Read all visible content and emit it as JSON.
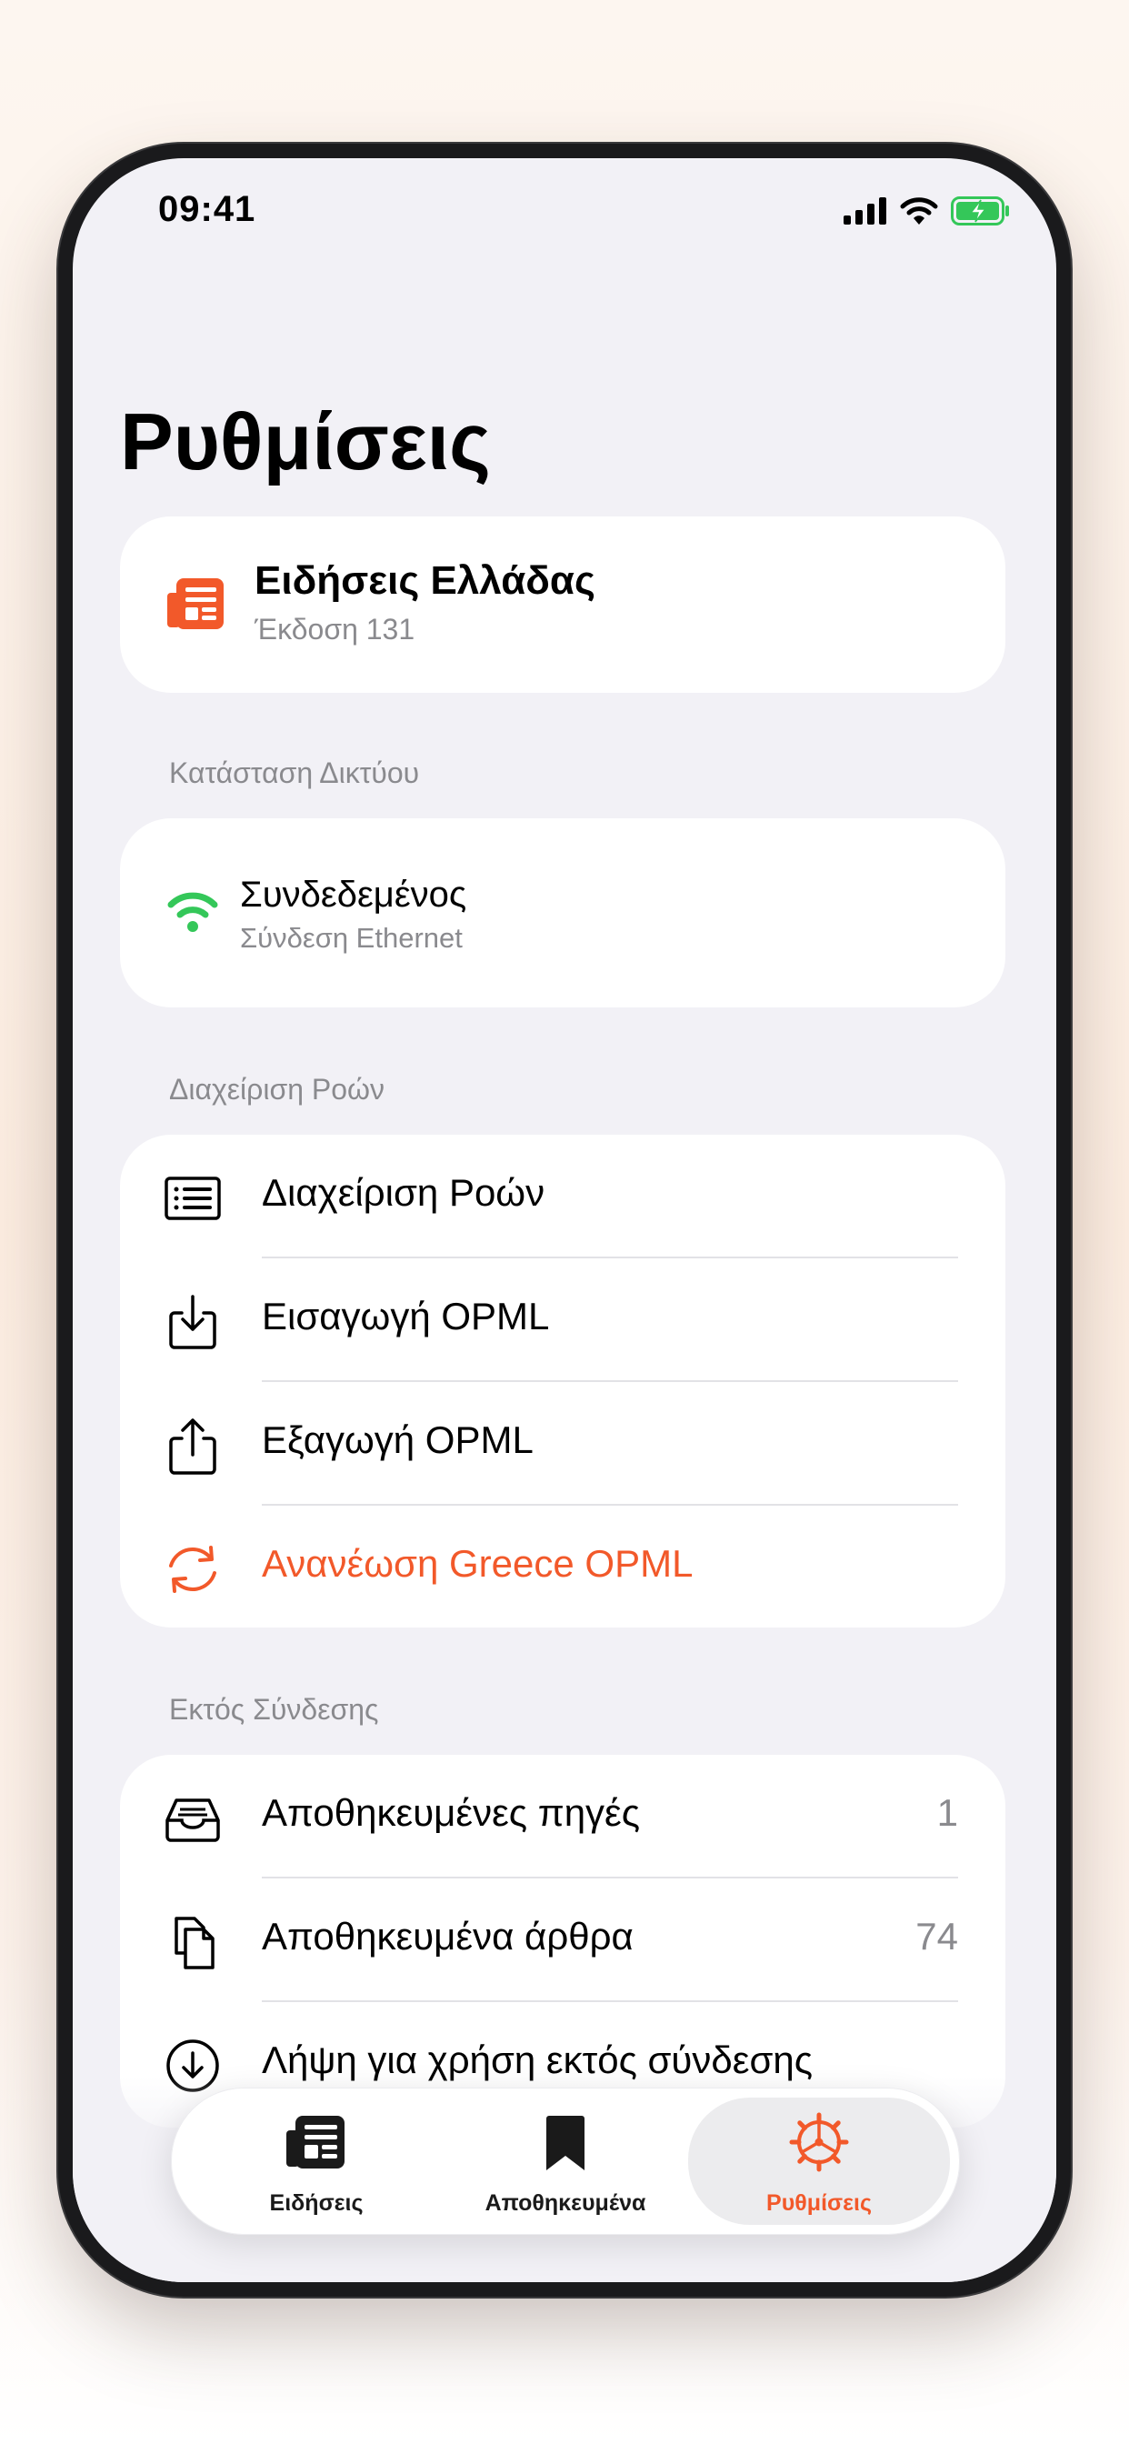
{
  "status_bar": {
    "time": "09:41"
  },
  "page": {
    "title": "Ρυθμίσεις"
  },
  "app_card": {
    "name": "Ειδήσεις Ελλάδας",
    "version": "Έκδοση 131"
  },
  "network": {
    "header": "Κατάσταση Δικτύου",
    "status": "Συνδεδεμένος",
    "detail": "Σύνδεση Ethernet",
    "icon": "wifi-icon",
    "color": "#34c759"
  },
  "feeds": {
    "header": "Διαχείριση Ροών",
    "items": [
      {
        "label": "Διαχείριση Ροών",
        "icon": "list-icon"
      },
      {
        "label": "Εισαγωγή OPML",
        "icon": "import-icon"
      },
      {
        "label": "Εξαγωγή OPML",
        "icon": "share-icon"
      },
      {
        "label": "Ανανέωση Greece OPML",
        "icon": "refresh-icon",
        "color": "#f2592a"
      }
    ]
  },
  "offline": {
    "header": "Εκτός Σύνδεσης",
    "items": [
      {
        "label": "Αποθηκευμένες πηγές",
        "value": "1",
        "icon": "tray-icon"
      },
      {
        "label": "Αποθηκευμένα άρθρα",
        "value": "74",
        "icon": "documents-icon"
      },
      {
        "label": "Λήψη για χρήση εκτός σύνδεσης",
        "icon": "download-icon"
      }
    ]
  },
  "tabbar": {
    "tabs": [
      {
        "label": "Ειδήσεις",
        "icon": "newspaper-icon",
        "active": false
      },
      {
        "label": "Αποθηκευμένα",
        "icon": "bookmark-icon",
        "active": false
      },
      {
        "label": "Ρυθμίσεις",
        "icon": "gear-icon",
        "active": true
      }
    ]
  },
  "colors": {
    "accent": "#f2592a",
    "background": "#f2f1f6",
    "secondary_text": "#8a8a8e"
  }
}
